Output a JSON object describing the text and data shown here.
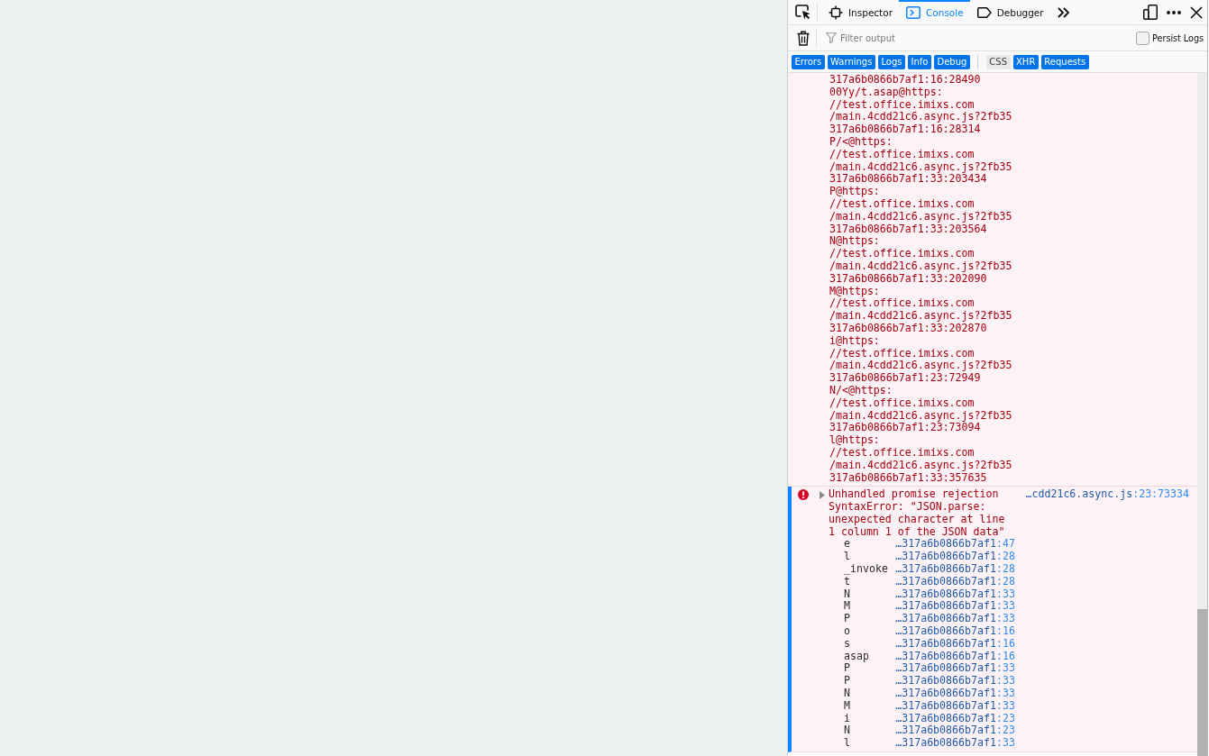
{
  "toolbox": {
    "tabs": [
      {
        "label": "Inspector",
        "kind": "inspector",
        "selected": false
      },
      {
        "label": "Console",
        "kind": "console",
        "selected": true
      },
      {
        "label": "Debugger",
        "kind": "debugger",
        "selected": false
      }
    ]
  },
  "console_toolbar": {
    "filter_field": {
      "placeholder": "Filter output"
    },
    "persist_logs": {
      "label": "Persist Logs",
      "checked": false
    }
  },
  "filter_buttons": {
    "levels": [
      {
        "label": "Errors",
        "selected": true
      },
      {
        "label": "Warnings",
        "selected": true
      },
      {
        "label": "Logs",
        "selected": true
      },
      {
        "label": "Info",
        "selected": true
      },
      {
        "label": "Debug",
        "selected": true
      }
    ],
    "categories": [
      {
        "label": "CSS",
        "selected": false
      },
      {
        "label": "XHR",
        "selected": true
      },
      {
        "label": "Requests",
        "selected": true
      }
    ]
  },
  "messages": [
    {
      "kind": "error",
      "selected": false,
      "stack_lines": [
        "317a6b0866b7af1:16:28490",
        "00Yy/t.asap@https:",
        "//test.office.imixs.com",
        "/main.4cdd21c6.async.js?2fb35",
        "317a6b0866b7af1:16:28314",
        "P/<@https:",
        "//test.office.imixs.com",
        "/main.4cdd21c6.async.js?2fb35",
        "317a6b0866b7af1:33:203434",
        "P@https:",
        "//test.office.imixs.com",
        "/main.4cdd21c6.async.js?2fb35",
        "317a6b0866b7af1:33:203564",
        "N@https:",
        "//test.office.imixs.com",
        "/main.4cdd21c6.async.js?2fb35",
        "317a6b0866b7af1:33:202090",
        "M@https:",
        "//test.office.imixs.com",
        "/main.4cdd21c6.async.js?2fb35",
        "317a6b0866b7af1:33:202870",
        "i@https:",
        "//test.office.imixs.com",
        "/main.4cdd21c6.async.js?2fb35",
        "317a6b0866b7af1:23:72949",
        "N/<@https:",
        "//test.office.imixs.com",
        "/main.4cdd21c6.async.js?2fb35",
        "317a6b0866b7af1:23:73094",
        "l@https:",
        "//test.office.imixs.com",
        "/main.4cdd21c6.async.js?2fb35",
        "317a6b0866b7af1:33:357635"
      ]
    },
    {
      "kind": "error",
      "selected": true,
      "expanded": false,
      "text": "Unhandled promise rejection SyntaxError: \"JSON.parse: unexpected character at line 1 column 1 of the JSON data\"",
      "source": "…cdd21c6.async.js",
      "position": ":23:73334",
      "frames": [
        {
          "function": "e",
          "source": "…317a6b0866b7af1",
          "position": ":47"
        },
        {
          "function": "l",
          "source": "…317a6b0866b7af1",
          "position": ":28"
        },
        {
          "function": "_invoke",
          "source": "…317a6b0866b7af1",
          "position": ":28"
        },
        {
          "function": "t",
          "source": "…317a6b0866b7af1",
          "position": ":28"
        },
        {
          "function": "N",
          "source": "…317a6b0866b7af1",
          "position": ":33"
        },
        {
          "function": "M",
          "source": "…317a6b0866b7af1",
          "position": ":33"
        },
        {
          "function": "P",
          "source": "…317a6b0866b7af1",
          "position": ":33"
        },
        {
          "function": "o",
          "source": "…317a6b0866b7af1",
          "position": ":16"
        },
        {
          "function": "s",
          "source": "…317a6b0866b7af1",
          "position": ":16"
        },
        {
          "function": "asap",
          "source": "…317a6b0866b7af1",
          "position": ":16"
        },
        {
          "function": "P",
          "source": "…317a6b0866b7af1",
          "position": ":33"
        },
        {
          "function": "P",
          "source": "…317a6b0866b7af1",
          "position": ":33"
        },
        {
          "function": "N",
          "source": "…317a6b0866b7af1",
          "position": ":33"
        },
        {
          "function": "M",
          "source": "…317a6b0866b7af1",
          "position": ":33"
        },
        {
          "function": "i",
          "source": "…317a6b0866b7af1",
          "position": ":23"
        },
        {
          "function": "N",
          "source": "…317a6b0866b7af1",
          "position": ":23"
        },
        {
          "function": "l",
          "source": "…317a6b0866b7af1",
          "position": ":33"
        }
      ]
    }
  ]
}
